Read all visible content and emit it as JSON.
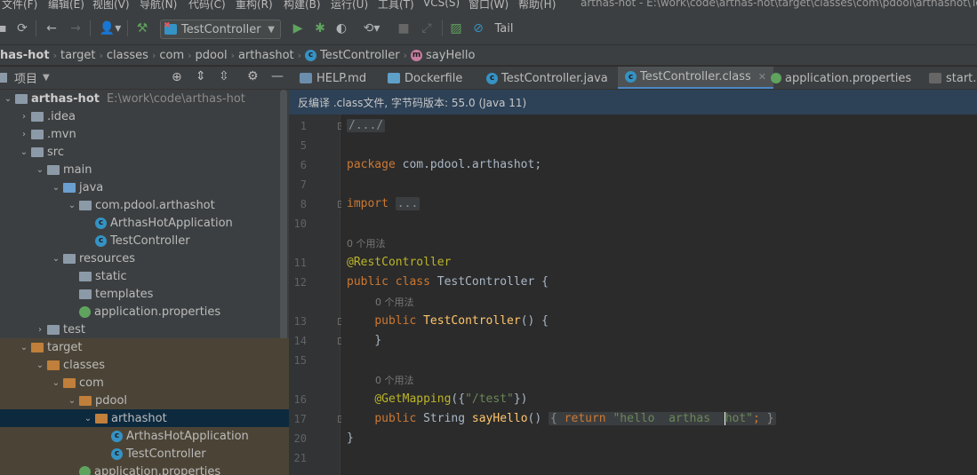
{
  "menu": {
    "items": [
      "文件(F)",
      "编辑(E)",
      "视图(V)",
      "导航(N)",
      "代码(C)",
      "重构(R)",
      "构建(B)",
      "运行(U)",
      "工具(T)",
      "VCS(S)",
      "窗口(W)",
      "帮助(H)"
    ],
    "window_title": "arthas-hot - E:\\work\\code\\arthas-hot\\target\\classes\\com\\pdool\\arthashot\\TestController.class"
  },
  "toolbar": {
    "run_config": "TestController",
    "tail_label": "Tail"
  },
  "breadcrumb": [
    "has-hot",
    "target",
    "classes",
    "com",
    "pdool",
    "arthashot",
    "TestController",
    "sayHello"
  ],
  "project": {
    "title": "项目",
    "tree": [
      {
        "label": "arthas-hot",
        "extra": "E:\\work\\code\\arthas-hot",
        "depth": 0,
        "arrow": "down",
        "icon": "module-folder"
      },
      {
        "label": ".idea",
        "depth": 1,
        "arrow": "right",
        "icon": "folder"
      },
      {
        "label": ".mvn",
        "depth": 1,
        "arrow": "right",
        "icon": "folder"
      },
      {
        "label": "src",
        "depth": 1,
        "arrow": "down",
        "icon": "folder"
      },
      {
        "label": "main",
        "depth": 2,
        "arrow": "down",
        "icon": "folder"
      },
      {
        "label": "java",
        "depth": 3,
        "arrow": "down",
        "icon": "source-folder"
      },
      {
        "label": "com.pdool.arthashot",
        "depth": 4,
        "arrow": "down",
        "icon": "package"
      },
      {
        "label": "ArthasHotApplication",
        "depth": 5,
        "arrow": "",
        "icon": "spring-class"
      },
      {
        "label": "TestController",
        "depth": 5,
        "arrow": "",
        "icon": "class"
      },
      {
        "label": "resources",
        "depth": 3,
        "arrow": "down",
        "icon": "resources-folder"
      },
      {
        "label": "static",
        "depth": 4,
        "arrow": "",
        "icon": "folder"
      },
      {
        "label": "templates",
        "depth": 4,
        "arrow": "",
        "icon": "folder"
      },
      {
        "label": "application.properties",
        "depth": 4,
        "arrow": "",
        "icon": "spring-properties"
      },
      {
        "label": "test",
        "depth": 2,
        "arrow": "right",
        "icon": "folder"
      },
      {
        "label": "target",
        "depth": 1,
        "arrow": "down",
        "icon": "excluded-folder",
        "excluded": true
      },
      {
        "label": "classes",
        "depth": 2,
        "arrow": "down",
        "icon": "excluded-folder",
        "excluded": true
      },
      {
        "label": "com",
        "depth": 3,
        "arrow": "down",
        "icon": "excluded-folder",
        "excluded": true
      },
      {
        "label": "pdool",
        "depth": 4,
        "arrow": "down",
        "icon": "excluded-folder",
        "excluded": true
      },
      {
        "label": "arthashot",
        "depth": 5,
        "arrow": "down",
        "icon": "excluded-folder",
        "selected": true
      },
      {
        "label": "ArthasHotApplication",
        "depth": 6,
        "arrow": "",
        "icon": "class",
        "excluded": true
      },
      {
        "label": "TestController",
        "depth": 6,
        "arrow": "",
        "icon": "class",
        "excluded": true
      },
      {
        "label": "application.properties",
        "depth": 4,
        "arrow": "",
        "icon": "spring-properties",
        "excluded": true
      }
    ]
  },
  "tabs": [
    {
      "label": "HELP.md",
      "icon": "markdown-icon"
    },
    {
      "label": "Dockerfile",
      "icon": "docker-icon"
    },
    {
      "label": "TestController.java",
      "icon": "class-icon"
    },
    {
      "label": "TestController.class",
      "icon": "class-icon",
      "active": true
    },
    {
      "label": "application.properties",
      "icon": "spring-icon"
    },
    {
      "label": "start.s",
      "icon": "script-icon"
    }
  ],
  "notice": "反编译 .class文件, 字节码版本: 55.0 (Java 11)",
  "editor": {
    "line_numbers": [
      "1",
      "5",
      "6",
      "7",
      "8",
      "10",
      "11",
      "12",
      "13",
      "14",
      "15",
      "16",
      "17",
      "20",
      "21"
    ],
    "usage_hint": "0 个用法",
    "lines": {
      "l1": "/.../",
      "l6_kw": "package",
      "l6_rest": " com.pdool.arthashot;",
      "l8_kw": "import",
      "l8_fold": "...",
      "l11": "@RestController",
      "l12_kw": "public class",
      "l12_rest": " TestController {",
      "l13_kw": "public",
      "l13_fn": "TestController",
      "l13_rest": "() {",
      "l14": "}",
      "l16_ann": "@GetMapping",
      "l16_pre": "({",
      "l16_str": "\"/test\"",
      "l16_post": "})",
      "l17_kw": "public",
      "l17_type": " String ",
      "l17_fn": "sayHello",
      "l17_paren": "()",
      "l17_ob": "{",
      "l17_ret": "return",
      "l17_str1": "\"hello  arthas  ",
      "l17_str2": "hot\"",
      "l17_semi": ";",
      "l17_cb": "}",
      "l20": "}"
    }
  }
}
